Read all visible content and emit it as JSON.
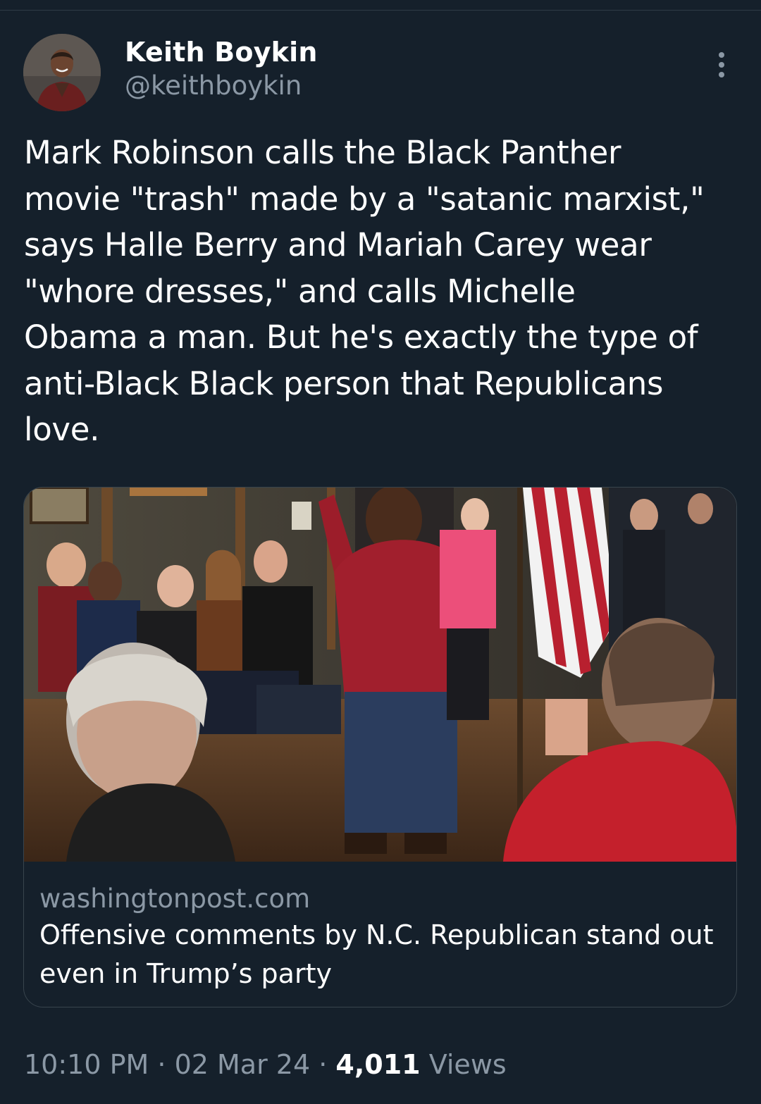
{
  "author": {
    "display_name": "Keith Boykin",
    "handle": "@keithboykin",
    "avatar_icon": "profile-photo"
  },
  "menu": {
    "icon": "more-options-icon"
  },
  "tweet": {
    "text": "Mark Robinson calls the Black Panther\nmovie \"trash\" made by a \"satanic marxist,\"\nsays Halle Berry and Mariah Carey wear\n\"whore dresses,\" and calls Michelle\nObama a man. But he's exactly the type of\nanti-Black Black person that Republicans\nlove."
  },
  "link_card": {
    "image_icon": "article-photo",
    "domain": "washingtonpost.com",
    "title": "Offensive comments by N.C. Republican stand out even in Trump’s party"
  },
  "meta": {
    "time": "10:10 PM",
    "date": "02 Mar 24",
    "separator": "·",
    "views_count": "4,011",
    "views_label": "Views"
  },
  "colors": {
    "background": "#15202b",
    "secondary_text": "#8b98a5",
    "card_border": "#38444d"
  }
}
